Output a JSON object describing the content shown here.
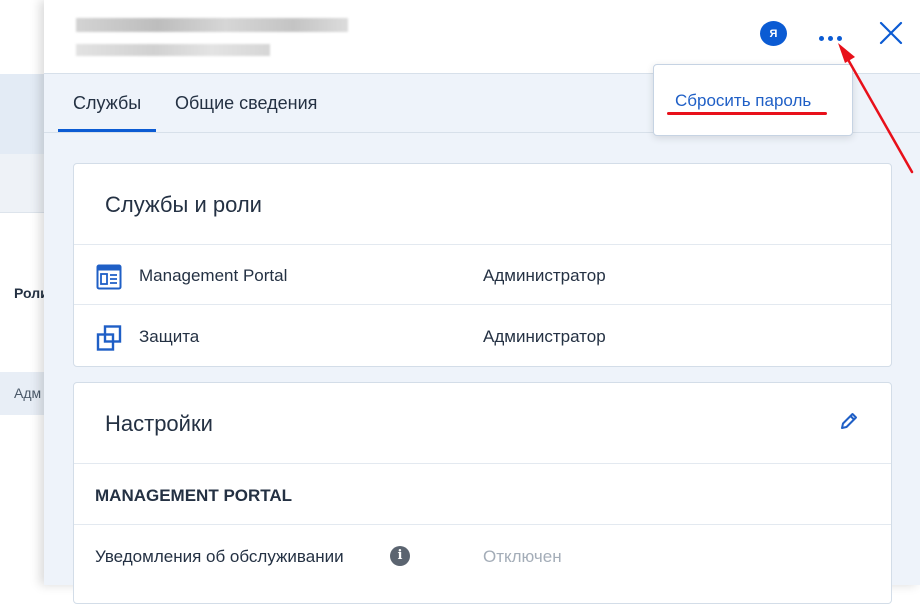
{
  "background_page": {
    "column_header": "Роли",
    "row_value": "Адм"
  },
  "header": {
    "avatar_initial": "Я",
    "more_icon": "more-horizontal-icon",
    "close_icon": "close-icon"
  },
  "tabs": [
    {
      "label": "Службы",
      "active": true
    },
    {
      "label": "Общие сведения",
      "active": false
    }
  ],
  "more_menu": {
    "items": [
      {
        "label": "Сбросить пароль"
      }
    ]
  },
  "services_card": {
    "title": "Службы и роли",
    "rows": [
      {
        "icon": "management-portal-icon",
        "name": "Management Portal",
        "role": "Администратор"
      },
      {
        "icon": "protection-icon",
        "name": "Защита",
        "role": "Администратор"
      }
    ]
  },
  "settings_card": {
    "title": "Настройки",
    "edit_icon": "pencil-icon",
    "section": "MANAGEMENT PORTAL",
    "setting_label": "Уведомления об обслуживании",
    "setting_info_icon": "info-icon",
    "setting_value": "Отключен"
  },
  "colors": {
    "accent": "#0b5bd3",
    "link": "#1f5fc6",
    "annotation_red": "#e8101a",
    "panel_bg": "#eef3fa"
  }
}
